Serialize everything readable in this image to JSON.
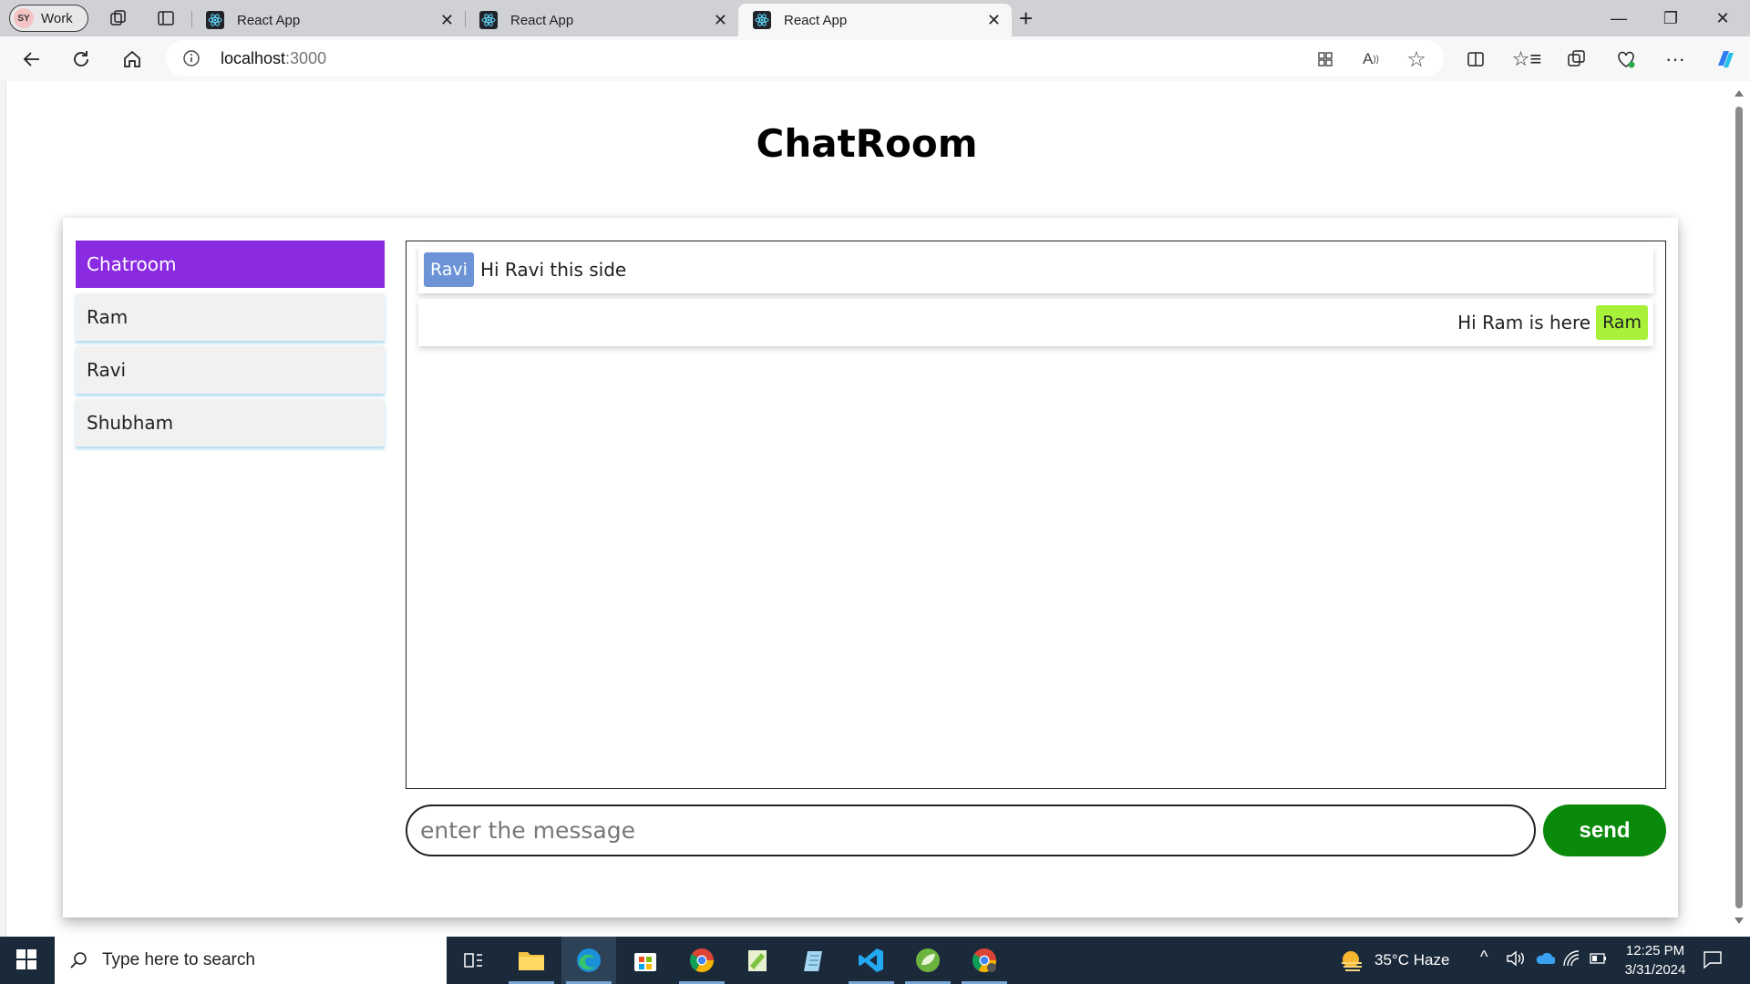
{
  "browser": {
    "profile_initials": "SY",
    "profile_name": "Work",
    "tabs": [
      {
        "title": "React App"
      },
      {
        "title": "React App"
      },
      {
        "title": "React App"
      }
    ],
    "url_host": "localhost",
    "url_port": ":3000"
  },
  "page": {
    "title": "ChatRoom",
    "sidebar": {
      "items": [
        {
          "label": "Chatroom"
        },
        {
          "label": "Ram"
        },
        {
          "label": "Ravi"
        },
        {
          "label": "Shubham"
        }
      ]
    },
    "messages": [
      {
        "sender": "Ravi",
        "text": "Hi Ravi this side",
        "side": "left",
        "badge_color": "#6b93d6"
      },
      {
        "sender": "Ram",
        "text": "Hi Ram is here",
        "side": "right",
        "badge_color": "#a7f13a"
      }
    ],
    "input_placeholder": "enter the message",
    "send_label": "send",
    "colors": {
      "active_item": "#8a2be2",
      "send_button": "#0a8a0a"
    }
  },
  "taskbar": {
    "search_placeholder": "Type here to search",
    "weather": "35°C  Haze",
    "time": "12:25 PM",
    "date": "3/31/2024"
  }
}
